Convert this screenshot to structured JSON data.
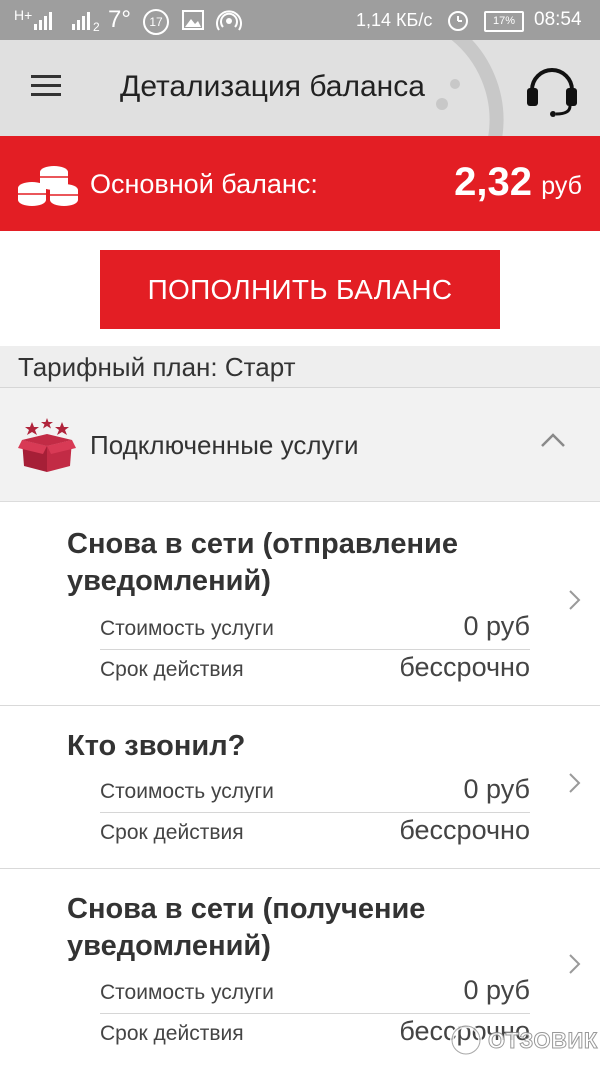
{
  "status_bar": {
    "signal1": "H+",
    "signal2": "2",
    "temperature": "7°",
    "notif_count": "17",
    "net_speed": "1,14 КБ/с",
    "battery": "17%",
    "time": "08:54"
  },
  "app_bar": {
    "title": "Детализация баланса",
    "icons": [
      "menu-icon",
      "headset-icon"
    ]
  },
  "balance": {
    "label": "Основной баланс:",
    "amount": "2,32",
    "unit": "руб",
    "icon": "coins-icon"
  },
  "topup_button": "ПОПОЛНИТЬ БАЛАНС",
  "tariff": "Тарифный план: Старт",
  "services_section": {
    "title": "Подключенные услуги",
    "icon": "gift-box-icon",
    "expanded": true
  },
  "services": [
    {
      "name": "Снова в сети (отправление уведомлений)",
      "cost_label": "Стоимость услуги",
      "cost_value": "0 руб",
      "term_label": "Срок действия",
      "term_value": "бессрочно"
    },
    {
      "name": "Кто звонил?",
      "cost_label": "Стоимость услуги",
      "cost_value": "0 руб",
      "term_label": "Срок действия",
      "term_value": "бессрочно"
    },
    {
      "name": "Снова в сети (получение уведомлений)",
      "cost_label": "Стоимость услуги",
      "cost_value": "0 руб",
      "term_label": "Срок действия",
      "term_value": "бессрочно"
    }
  ],
  "watermark": "ОТЗОВИК",
  "colors": {
    "accent_red": "#e31e24",
    "status_bar": "#9e9e9e",
    "app_bar": "#e0e0e0"
  }
}
